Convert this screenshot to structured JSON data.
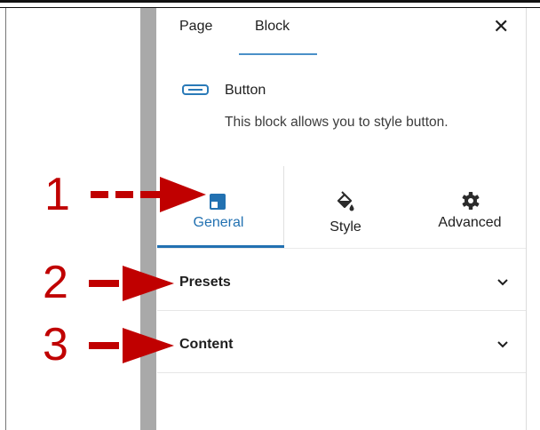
{
  "tabs": {
    "page": "Page",
    "block": "Block"
  },
  "block": {
    "name": "Button",
    "description": "This block allows you to style button.",
    "icon": "button-block-icon"
  },
  "subtabs": [
    {
      "label": "General",
      "icon": "general-icon",
      "active": true
    },
    {
      "label": "Style",
      "icon": "paint-bucket-icon",
      "active": false
    },
    {
      "label": "Advanced",
      "icon": "gear-icon",
      "active": false
    }
  ],
  "sections": [
    {
      "title": "Presets"
    },
    {
      "title": "Content"
    }
  ],
  "annotations": [
    "1",
    "2",
    "3"
  ],
  "colors": {
    "accent": "#2271b1",
    "annotation": "#c00000",
    "scrollbar": "#a9a9a9"
  }
}
